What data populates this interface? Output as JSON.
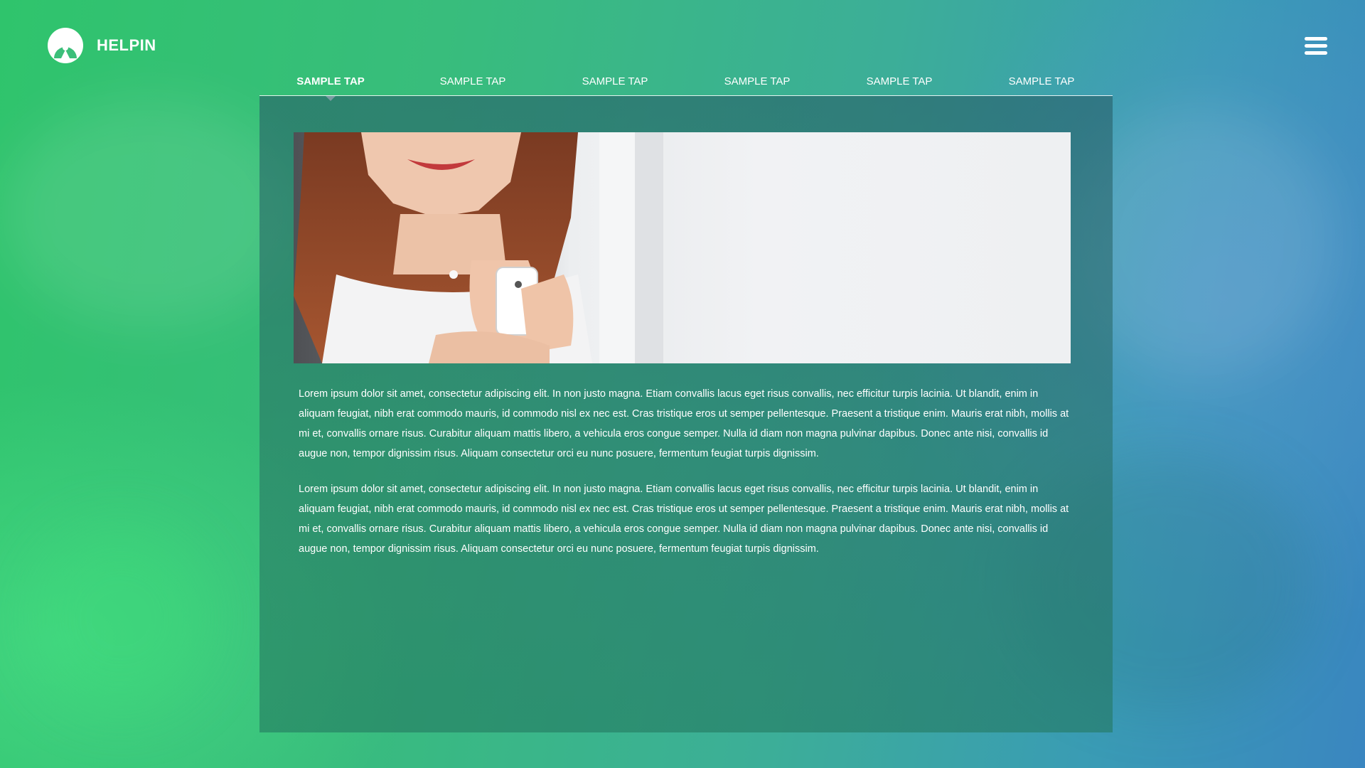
{
  "brand": {
    "name": "HELPIN",
    "logo_icon": "helpin-logo-icon"
  },
  "header": {
    "menu_icon": "hamburger-menu-icon"
  },
  "tabs": [
    {
      "label": "SAMPLE TAP",
      "active": true
    },
    {
      "label": "SAMPLE TAP",
      "active": false
    },
    {
      "label": "SAMPLE TAP",
      "active": false
    },
    {
      "label": "SAMPLE TAP",
      "active": false
    },
    {
      "label": "SAMPLE TAP",
      "active": false
    },
    {
      "label": "SAMPLE TAP",
      "active": false
    }
  ],
  "main": {
    "paragraphs": [
      "Lorem ipsum dolor sit amet, consectetur adipiscing elit. In non justo magna. Etiam convallis lacus eget risus convallis, nec efficitur turpis lacinia. Ut blandit, enim in aliquam feugiat, nibh erat commodo mauris, id commodo nisl ex nec est. Cras tristique eros ut semper pellentesque. Praesent a tristique enim. Mauris erat nibh, mollis at mi et, convallis ornare risus. Curabitur aliquam mattis libero, a vehicula eros congue semper. Nulla id diam non magna pulvinar dapibus. Donec ante nisi, convallis id augue non, tempor dignissim risus. Aliquam consectetur orci eu nunc posuere, fermentum feugiat turpis dignissim.",
      "Lorem ipsum dolor sit amet, consectetur adipiscing elit. In non justo magna. Etiam convallis lacus eget risus convallis, nec efficitur turpis lacinia. Ut blandit, enim in aliquam feugiat, nibh erat commodo mauris, id commodo nisl ex nec est. Cras tristique eros ut semper pellentesque. Praesent a tristique enim. Mauris erat nibh, mollis at mi et, convallis ornare risus. Curabitur aliquam mattis libero, a vehicula eros congue semper. Nulla id diam non magna pulvinar dapibus. Donec ante nisi, convallis id augue non, tempor dignissim risus. Aliquam consectetur orci eu nunc posuere, fermentum feugiat turpis dignissim."
    ]
  },
  "colors": {
    "background_left": "#2fc46c",
    "background_right": "#3a86c0",
    "panel_overlay": "#286970",
    "text": "#ffffff"
  }
}
